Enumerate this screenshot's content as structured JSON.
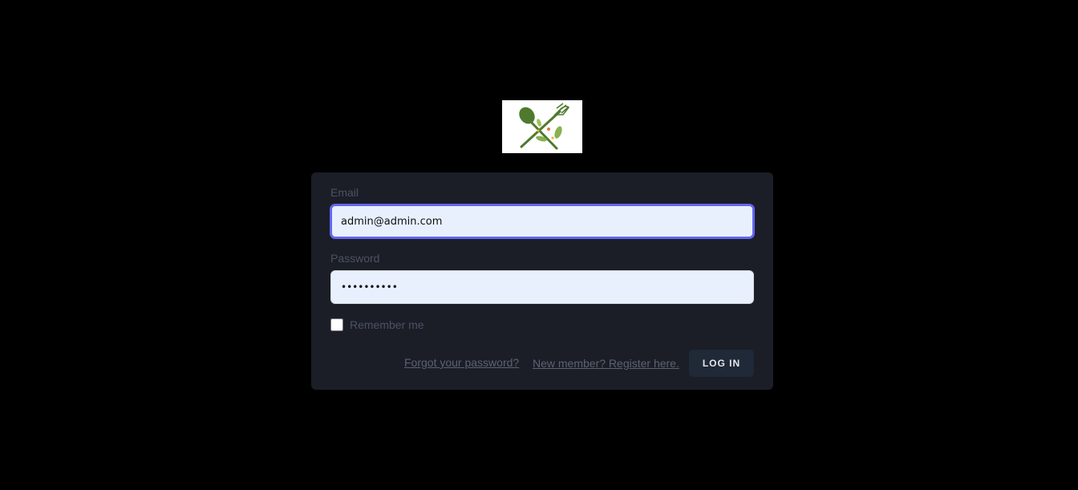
{
  "logo": {
    "icon": "fork-and-spoon-icon",
    "color": "#4a6b2a"
  },
  "form": {
    "email_label": "Email",
    "email_value": "admin@admin.com",
    "password_label": "Password",
    "password_value": "••••••••••",
    "remember_label": "Remember me",
    "remember_checked": false,
    "forgot_link": "Forgot your password?",
    "register_link": "New member? Register here.",
    "login_button": "LOG IN"
  },
  "colors": {
    "background": "#000000",
    "card": "#1b1e27",
    "input_background": "#e8f0fe",
    "focus_ring": "#6366f1",
    "button": "#1f2937"
  }
}
